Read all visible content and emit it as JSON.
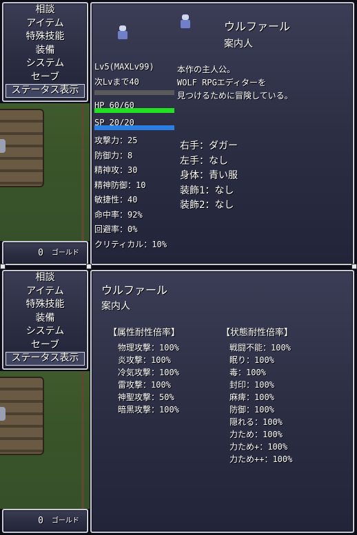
{
  "menu": {
    "items": [
      "相談",
      "アイテム",
      "特殊技能",
      "装備",
      "システム",
      "セーブ",
      "ステータス表示"
    ],
    "selected_index": 6
  },
  "gold": {
    "amount": "0",
    "unit": "ゴールド"
  },
  "status": {
    "name": "ウルファール",
    "title": "案内人",
    "level_line": "Lv5(MAXLv99)",
    "next_line": "次Lvまで40",
    "description": [
      "本作の主人公。",
      "WOLF RPGエディターを",
      "見つけるために冒険している。"
    ],
    "hp_label": "HP  60/60",
    "sp_label": "SP  20/20",
    "hp_fraction": 1.0,
    "sp_fraction": 1.0,
    "stats": [
      "攻撃力：25",
      "防御力：8",
      "精神攻：30",
      "精神防御：10",
      "敏捷性：40",
      "命中率：92%",
      "回避率：0%",
      "クリティカル：10%"
    ],
    "equipment": [
      "右手：ダガー",
      "左手：なし",
      "身体：青い服",
      "装飾1：なし",
      "装飾2：なし"
    ]
  },
  "resist": {
    "name": "ウルファール",
    "title": "案内人",
    "attr_header": "【属性耐性倍率】",
    "state_header": "【状態耐性倍率】",
    "attr": [
      "物理攻撃：100%",
      "炎攻撃：100%",
      "冷気攻撃：100%",
      "雷攻撃：100%",
      "神聖攻撃：50%",
      "暗黒攻撃：100%"
    ],
    "state": [
      "戦闘不能：100%",
      "眠り：100%",
      "毒：100%",
      "封印：100%",
      "麻痺：100%",
      "防御：100%",
      "隠れる：100%",
      "力ため：100%",
      "力ため+：100%",
      "力ため++：100%"
    ]
  },
  "colors": {
    "hp_bar": "#22e022",
    "sp_bar": "#2a7fe0",
    "hp_bar_empty": "#5a5a5a"
  }
}
